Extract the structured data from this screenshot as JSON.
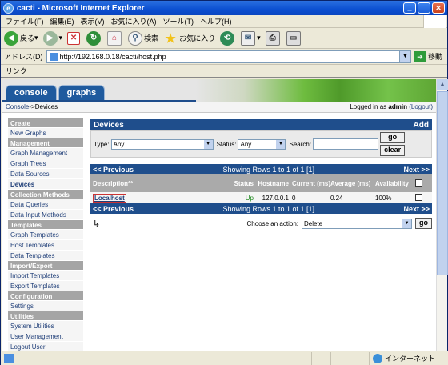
{
  "window": {
    "title": "cacti - Microsoft Internet Explorer"
  },
  "menu": [
    "ファイル(F)",
    "編集(E)",
    "表示(V)",
    "お気に入り(A)",
    "ツール(T)",
    "ヘルプ(H)"
  ],
  "toolbar": {
    "back": "戻る",
    "search": "検索",
    "favorites": "お気に入り"
  },
  "address": {
    "label": "アドレス(D)",
    "url": "http://192.168.0.18/cacti/host.php",
    "go": "移動"
  },
  "links": {
    "label": "リンク"
  },
  "tabs": [
    "console",
    "graphs"
  ],
  "breadcrumb": {
    "console": "Console",
    "sep": " -> ",
    "current": "Devices"
  },
  "login": {
    "prefix": "Logged in as ",
    "user": "admin",
    "logout": "(Logout)"
  },
  "sidebar": [
    {
      "type": "head",
      "label": "Create"
    },
    {
      "type": "item",
      "label": "New Graphs"
    },
    {
      "type": "head",
      "label": "Management"
    },
    {
      "type": "item",
      "label": "Graph Management"
    },
    {
      "type": "item",
      "label": "Graph Trees"
    },
    {
      "type": "item",
      "label": "Data Sources"
    },
    {
      "type": "item",
      "label": "Devices",
      "active": true
    },
    {
      "type": "head",
      "label": "Collection Methods"
    },
    {
      "type": "item",
      "label": "Data Queries"
    },
    {
      "type": "item",
      "label": "Data Input Methods"
    },
    {
      "type": "head",
      "label": "Templates"
    },
    {
      "type": "item",
      "label": "Graph Templates"
    },
    {
      "type": "item",
      "label": "Host Templates"
    },
    {
      "type": "item",
      "label": "Data Templates"
    },
    {
      "type": "head",
      "label": "Import/Export"
    },
    {
      "type": "item",
      "label": "Import Templates"
    },
    {
      "type": "item",
      "label": "Export Templates"
    },
    {
      "type": "head",
      "label": "Configuration"
    },
    {
      "type": "item",
      "label": "Settings"
    },
    {
      "type": "head",
      "label": "Utilities"
    },
    {
      "type": "item",
      "label": "System Utilities"
    },
    {
      "type": "item",
      "label": "User Management"
    },
    {
      "type": "item",
      "label": "Logout User"
    }
  ],
  "devices": {
    "title": "Devices",
    "add": "Add",
    "type_label": "Type:",
    "type_value": "Any",
    "status_label": "Status:",
    "status_value": "Any",
    "search_label": "Search:",
    "search_value": "",
    "go": "go",
    "clear": "clear"
  },
  "pager": {
    "prev": "<< Previous",
    "showing": "Showing Rows 1 to 1 of 1 [1]",
    "next": "Next >>"
  },
  "table": {
    "headers": {
      "desc": "Description**",
      "status": "Status",
      "hostname": "Hostname",
      "current": "Current (ms)",
      "average": "Average (ms)",
      "availability": "Availability"
    },
    "rows": [
      {
        "desc": "Localhost",
        "status": "Up",
        "hostname": "127.0.0.1",
        "current": "0",
        "average": "0.24",
        "availability": "100%"
      }
    ]
  },
  "action": {
    "label": "Choose an action:",
    "selected": "Delete",
    "go": "go"
  },
  "statusbar": {
    "zone": "インターネット"
  },
  "colors": {
    "header_blue": "#1f4e8c",
    "nav_head": "#a5a5a5",
    "status_up": "#1f8a1f"
  }
}
